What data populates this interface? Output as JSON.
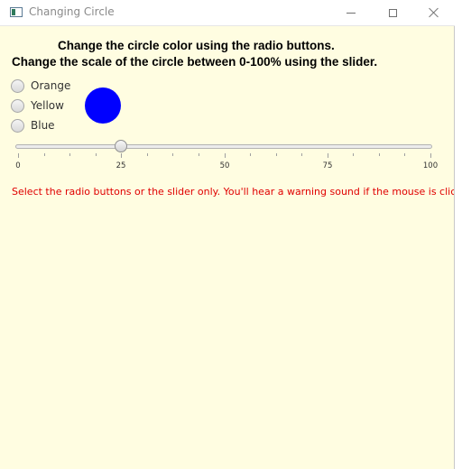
{
  "window": {
    "title": "Changing Circle",
    "background": "#fffde1"
  },
  "instructions": {
    "line1": "Change the circle color using the radio buttons.",
    "line2": "Change the scale of the circle between 0-100% using the slider."
  },
  "radios": [
    {
      "label": "Orange",
      "selected": false
    },
    {
      "label": "Yellow",
      "selected": false
    },
    {
      "label": "Blue",
      "selected": false
    }
  ],
  "circle": {
    "color": "#0000ff"
  },
  "slider": {
    "min": 0,
    "max": 100,
    "value": 25,
    "major_ticks": [
      "0",
      "25",
      "50",
      "75",
      "100"
    ]
  },
  "warning": {
    "text": "Select the radio buttons or the slider only. You'll hear a warning sound if the mouse is clicked",
    "color": "#e00000"
  },
  "icons": {
    "app": "window-app-icon",
    "minimize": "minimize-icon",
    "maximize": "maximize-icon",
    "close": "close-icon"
  }
}
